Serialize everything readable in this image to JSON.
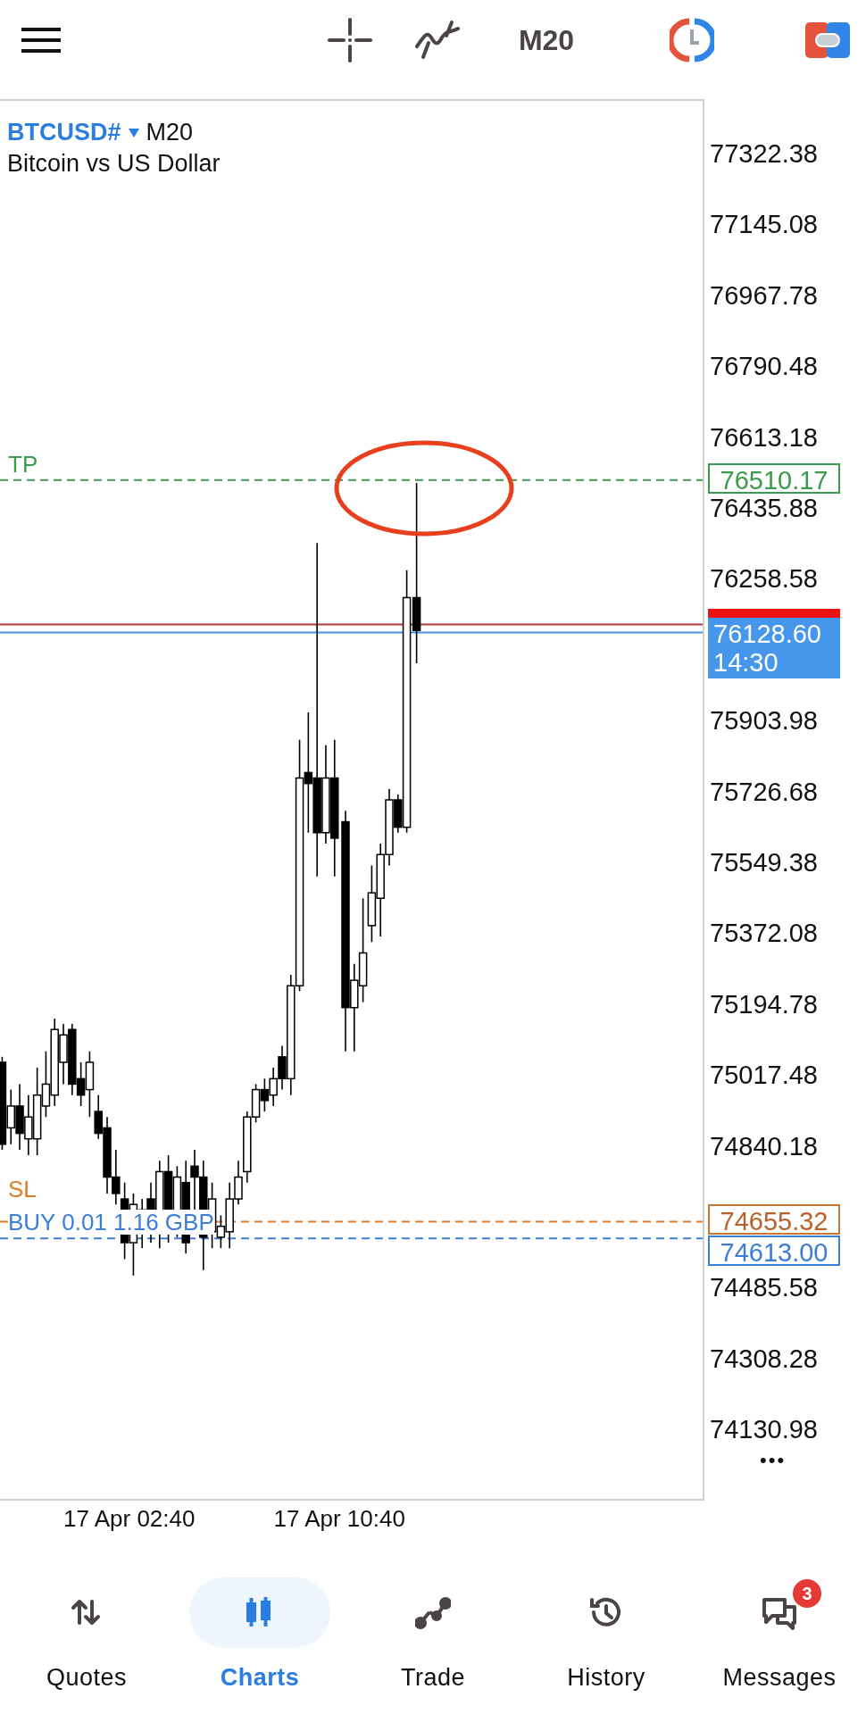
{
  "toolbar": {
    "timeframe": "M20"
  },
  "chart": {
    "symbol": "BTCUSD#",
    "timeframe": "M20",
    "description": "Bitcoin vs US Dollar",
    "price_scale": [
      "77322.38",
      "77145.08",
      "76967.78",
      "76790.48",
      "76613.18",
      "76435.88",
      "76258.58",
      "75903.98",
      "75726.68",
      "75549.38",
      "75372.08",
      "75194.78",
      "75017.48",
      "74840.18",
      "74485.58",
      "74308.28",
      "74130.98"
    ],
    "lines": [
      {
        "kind": "tp",
        "label": "TP",
        "price": "76510.17"
      },
      {
        "kind": "ask"
      },
      {
        "kind": "bid",
        "price": "76128.60",
        "countdown": "14:30"
      },
      {
        "kind": "sl",
        "label": "SL",
        "price": "74655.32"
      },
      {
        "kind": "position",
        "label": "BUY 0.01 1.16 GBP",
        "price": "74613.00"
      }
    ],
    "time_labels": [
      "17 Apr 02:40",
      "17 Apr 10:40"
    ],
    "more_button": "•••"
  },
  "nav": [
    {
      "kind": "quotes",
      "label": "Quotes",
      "selected": false
    },
    {
      "kind": "charts",
      "label": "Charts",
      "selected": true
    },
    {
      "kind": "trade",
      "label": "Trade",
      "selected": false
    },
    {
      "kind": "history",
      "label": "History",
      "selected": false
    },
    {
      "kind": "messages",
      "label": "Messages",
      "selected": false,
      "badge": "3"
    }
  ]
}
